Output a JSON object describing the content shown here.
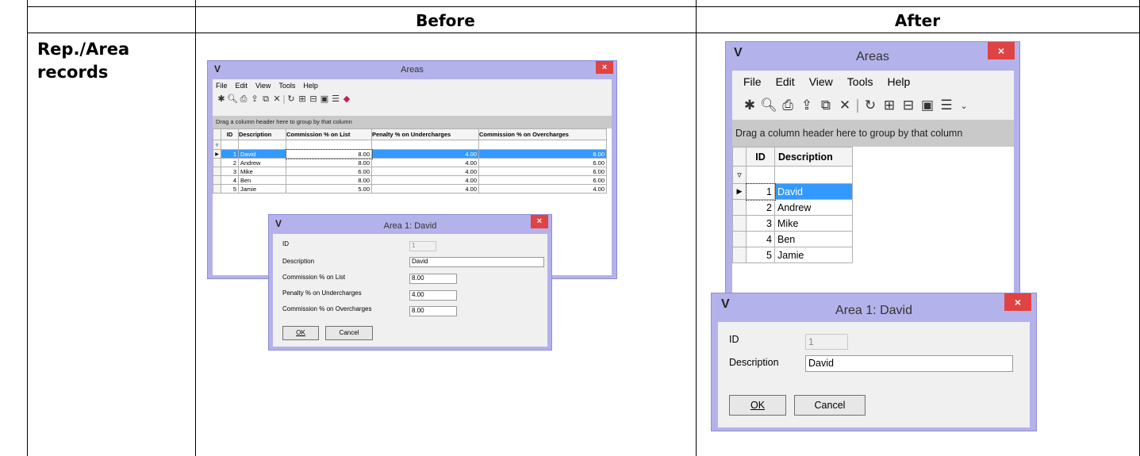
{
  "document": {
    "column_before": "Before",
    "column_after": "After",
    "row_label_line1": "Rep./Area",
    "row_label_line2": "records"
  },
  "before": {
    "areas_window": {
      "title": "Areas",
      "logo": "V",
      "close": "×",
      "menu": [
        "File",
        "Edit",
        "View",
        "Tools",
        "Help"
      ],
      "toolbar_icons": [
        "new-record-icon",
        "preview-icon",
        "print-icon",
        "export-icon",
        "copy-icon",
        "delete-icon",
        "refresh-icon",
        "expand-icon",
        "collapse-icon",
        "form-view-icon",
        "properties-icon",
        "eraser-icon"
      ],
      "group_hint": "Drag a column header here to group by that column",
      "columns": [
        "ID",
        "Description",
        "Commission % on List",
        "Penalty % on Undercharges",
        "Commission % on Overcharges"
      ],
      "rows": [
        {
          "id": "1",
          "description": "David",
          "commission_list": "8.00",
          "penalty_under": "4.00",
          "commission_over": "8.00"
        },
        {
          "id": "2",
          "description": "Andrew",
          "commission_list": "8.00",
          "penalty_under": "4.00",
          "commission_over": "6.00"
        },
        {
          "id": "3",
          "description": "Mike",
          "commission_list": "6.00",
          "penalty_under": "4.00",
          "commission_over": "6.00"
        },
        {
          "id": "4",
          "description": "Ben",
          "commission_list": "8.00",
          "penalty_under": "4.00",
          "commission_over": "6.00"
        },
        {
          "id": "5",
          "description": "Jamie",
          "commission_list": "5.00",
          "penalty_under": "4.00",
          "commission_over": "4.00"
        }
      ]
    },
    "dialog": {
      "title": "Area 1: David",
      "logo": "V",
      "close": "×",
      "id_label": "ID",
      "id_value": "1",
      "description_label": "Description",
      "description_value": "David",
      "commission_list_label": "Commission % on List",
      "commission_list_value": "8.00",
      "penalty_under_label": "Penalty % on Undercharges",
      "penalty_under_value": "4.00",
      "commission_over_label": "Commission % on Overcharges",
      "commission_over_value": "8.00",
      "ok": "OK",
      "cancel": "Cancel"
    }
  },
  "after": {
    "areas_window": {
      "title": "Areas",
      "logo": "V",
      "close": "×",
      "menu": [
        "File",
        "Edit",
        "View",
        "Tools",
        "Help"
      ],
      "toolbar_icons": [
        "new-record-icon",
        "preview-icon",
        "print-icon",
        "export-icon",
        "copy-icon",
        "delete-icon",
        "refresh-icon",
        "expand-icon",
        "collapse-icon",
        "form-view-icon",
        "properties-icon",
        "overflow-icon"
      ],
      "group_hint": "Drag a column header here to group by that column",
      "columns": [
        "ID",
        "Description"
      ],
      "rows": [
        {
          "id": "1",
          "description": "David"
        },
        {
          "id": "2",
          "description": "Andrew"
        },
        {
          "id": "3",
          "description": "Mike"
        },
        {
          "id": "4",
          "description": "Ben"
        },
        {
          "id": "5",
          "description": "Jamie"
        }
      ]
    },
    "dialog": {
      "title": "Area 1: David",
      "logo": "V",
      "close": "×",
      "id_label": "ID",
      "id_value": "1",
      "description_label": "Description",
      "description_value": "David",
      "ok": "OK",
      "cancel": "Cancel"
    }
  },
  "colors": {
    "window_frame": "#b4b2ea",
    "close_button": "#e04343",
    "selection": "#3399ff",
    "group_bar": "#c9c9c9"
  }
}
